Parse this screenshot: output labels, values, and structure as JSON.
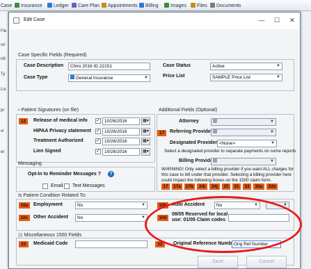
{
  "app_tabs": [
    {
      "label": "Case",
      "color": "#2a7bd3"
    },
    {
      "label": "Insurance",
      "color": "#3c8e3c"
    },
    {
      "label": "Ledger",
      "color": "#2a7bd3"
    },
    {
      "label": "Care Plan",
      "color": "#7a5ab8"
    },
    {
      "label": "Appointments",
      "color": "#c98a1c"
    },
    {
      "label": "Billing",
      "color": "#2a7bd3"
    },
    {
      "label": "Images",
      "color": "#3c8e3c"
    },
    {
      "label": "Files",
      "color": "#c98a1c"
    },
    {
      "label": "Documents",
      "color": "#7a7a7a"
    }
  ],
  "sidebar_fragments": [
    "Fie",
    "cri",
    "rdi",
    "Ty",
    "Lis",
    "pr",
    "vi",
    "er"
  ],
  "dialog": {
    "title": "Edit Case",
    "controls": {
      "minimize": "—",
      "maximize": "☐",
      "close": "✕"
    }
  },
  "case_specific": {
    "title": "Case Specific Fields (Required)",
    "description_label": "Case Description",
    "description_value": "Chiro 2016 ID 22151",
    "type_label": "Case Type",
    "type_value": "General Insurance",
    "status_label": "Case Status",
    "status_value": "Active",
    "price_list_label": "Price List",
    "price_list_value": "SAMPLE Price List"
  },
  "signatures": {
    "title": "Patient Signatures (on file)",
    "badge": "12",
    "rows": [
      {
        "label": "Release of medical info",
        "checked": true,
        "date": "10/26/2016"
      },
      {
        "label": "HIPAA Privacy statement",
        "checked": true,
        "date": "10/26/2016"
      },
      {
        "label": "Treatment Authorized",
        "checked": true,
        "date": "10/26/2016"
      },
      {
        "label": "Lien Signed",
        "checked": true,
        "date": "10/26/2016"
      }
    ]
  },
  "messaging": {
    "title": "Messaging",
    "opt_in_label": "Opt-In to Reminder Messages ?",
    "email_label": "Email",
    "text_label": "Text Messages",
    "help": "?"
  },
  "additional": {
    "title": "Additional Fields (Optional)",
    "attorney_label": "Attorney",
    "referring_badge": "17",
    "referring_label": "Referring Provider",
    "designated_label": "Designated Provider",
    "designated_value": "<None>",
    "designated_note": "Select a designated provider to separate payments on some reports",
    "billing_label": "Billing Provider",
    "warning": "WARNING! Only select a billing provider if you want ALL charges for this case to bill under that provider.  Selecting a billing provider here could impact the following boxes on the 1500 claim form.",
    "claim_boxes": [
      "17",
      "17a",
      "17b",
      "24i",
      "24j",
      "25",
      "31",
      "33",
      "33a",
      "33b"
    ]
  },
  "condition": {
    "title": "Is Patient Condition Related To:",
    "employment_badge": "10a",
    "employment_label": "Employment",
    "employment_value": "No",
    "other_badge": "10c",
    "other_label": "Other Accident",
    "other_value": "No",
    "auto_badge": "10b",
    "auto_label": "Auto Accident",
    "auto_value": "No",
    "reserved_badge": "10d",
    "reserved_label": "08/05 Reserved for local use: 01/05 Claim codes"
  },
  "misc": {
    "title": "Miscellaneous 1500 Fields",
    "medicaid_badge": "22",
    "medicaid_label": "Medicaid Code",
    "orig_ref_badge": "22",
    "orig_ref_label": "Original Reference Number",
    "orig_ref_value": "Orig Ref Number"
  },
  "buttons": {
    "save": "Save",
    "cancel": "Cancel"
  },
  "colors": {
    "badge": "#e55b12",
    "highlight_ring": "#e81a1a"
  }
}
